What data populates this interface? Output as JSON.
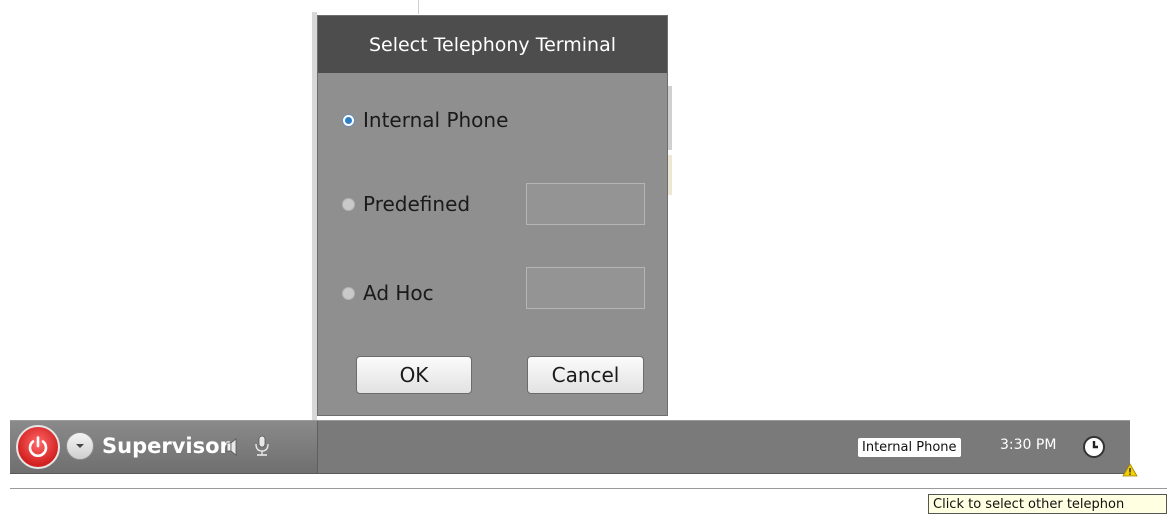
{
  "dialog": {
    "title": "Select Telephony Terminal",
    "options": [
      {
        "label": "Internal Phone",
        "selected": true
      },
      {
        "label": "Predefined",
        "selected": false,
        "value": ""
      },
      {
        "label": "Ad Hoc",
        "selected": false,
        "value": ""
      }
    ],
    "ok_label": "OK",
    "cancel_label": "Cancel"
  },
  "taskbar": {
    "power_icon": "power-icon",
    "dropdown_icon": "chevron-down-icon",
    "agent_name": "Supervisor",
    "speaker_icon": "speaker-icon",
    "mic_icon": "microphone-icon",
    "terminal_status": "Internal Phone",
    "time": "3:30 PM",
    "clock_icon": "clock-icon",
    "warning_icon": "warning-icon"
  },
  "tooltip": {
    "text": "Click to select other telephon"
  },
  "colors": {
    "dialog_header": "#4d4d4d",
    "dialog_body": "#8f8f8f",
    "taskbar": "#7a7a7a",
    "power_red": "#d21f1f",
    "radio_selected": "#2f7fc8",
    "tooltip_bg": "#ffffe1"
  }
}
